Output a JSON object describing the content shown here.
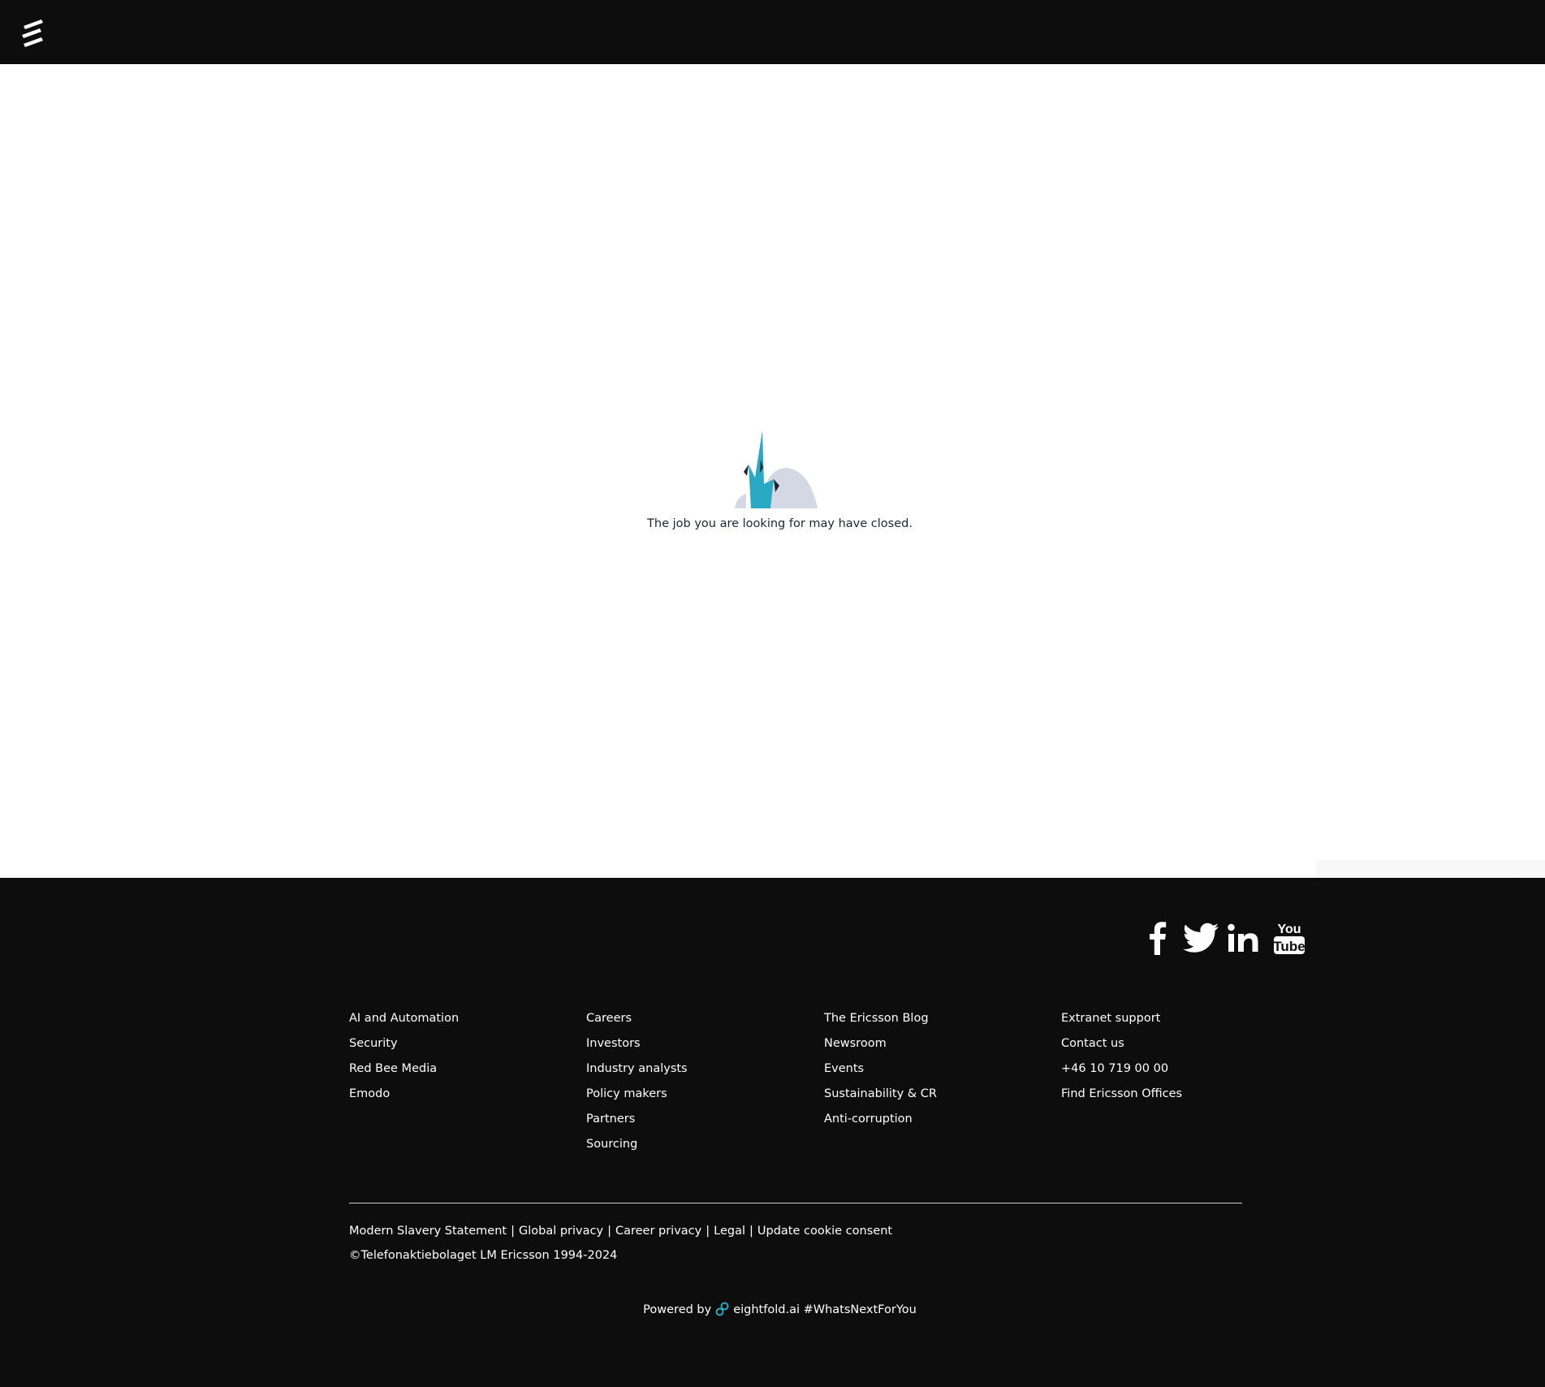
{
  "header": {
    "logo_name": "ericsson-logo"
  },
  "main": {
    "empty_state_message": "The job you are looking for may have closed."
  },
  "footer": {
    "social": [
      "facebook-icon",
      "twitter-icon",
      "linkedin-icon",
      "youtube-icon"
    ],
    "social_youtube_text": [
      "You",
      "Tube"
    ],
    "columns": [
      [
        "AI and Automation",
        "Security",
        "Red Bee Media",
        "Emodo"
      ],
      [
        "Careers",
        "Investors",
        "Industry analysts",
        "Policy makers",
        "Partners",
        "Sourcing"
      ],
      [
        "The Ericsson Blog",
        "Newsroom",
        "Events",
        "Sustainability & CR",
        "Anti-corruption"
      ],
      [
        "Extranet support",
        "Contact us",
        "+46 10 719 00 00",
        "Find Ericsson Offices"
      ]
    ],
    "legal_links": [
      "Modern Slavery Statement",
      "Global privacy",
      "Career privacy",
      "Legal",
      "Update cookie consent"
    ],
    "legal_separator": "|",
    "copyright": "©Telefonaktiebolaget LM Ericsson 1994-2024",
    "powered_by_prefix": "Powered by",
    "powered_by_brand": "eightfold.ai",
    "powered_by_hashtag": "#WhatsNextForYou"
  },
  "colors": {
    "header_bg": "#0d0d0d",
    "footer_bg": "#0d0d0d",
    "illustration_accent": "#2aa9c4",
    "illustration_hill": "#d3d8e2",
    "message_text": "#1f2433"
  }
}
